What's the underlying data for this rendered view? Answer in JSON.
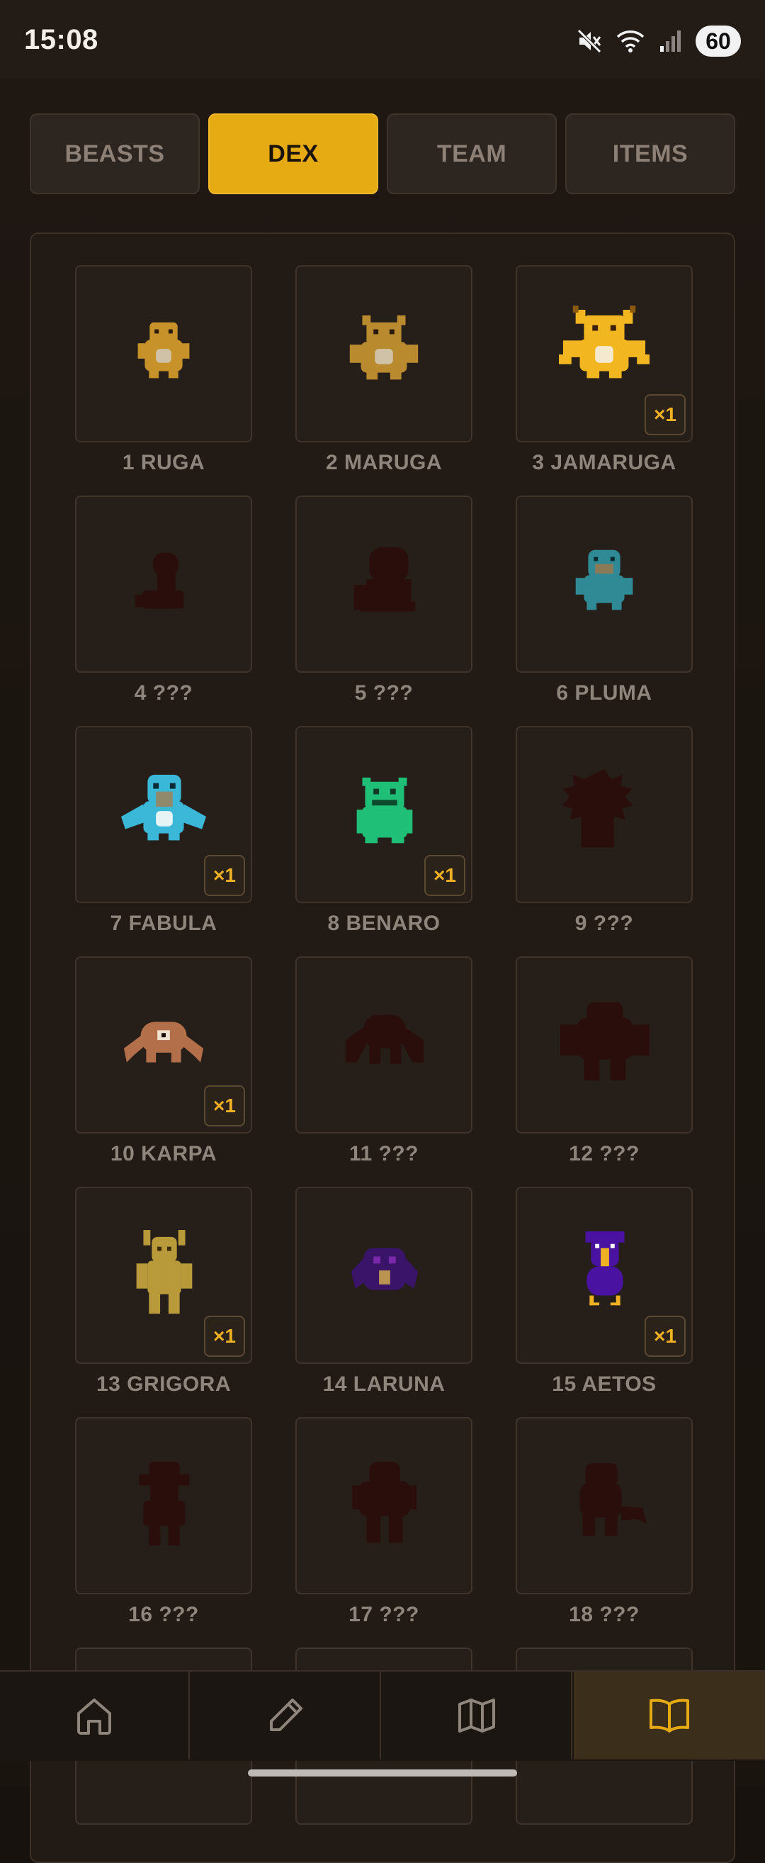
{
  "status": {
    "time": "15:08",
    "battery": "60"
  },
  "tabs": [
    {
      "label": "BEASTS",
      "active": false
    },
    {
      "label": "DEX",
      "active": true
    },
    {
      "label": "TEAM",
      "active": false
    },
    {
      "label": "ITEMS",
      "active": false
    }
  ],
  "dex": [
    {
      "label": "1 RUGA",
      "sprite": "ruga",
      "count": ""
    },
    {
      "label": "2 MARUGA",
      "sprite": "maruga",
      "count": ""
    },
    {
      "label": "3 JAMARUGA",
      "sprite": "jamaruga",
      "count": "×1"
    },
    {
      "label": "4 ???",
      "sprite": "silhouette-small",
      "count": ""
    },
    {
      "label": "5 ???",
      "sprite": "silhouette-medium",
      "count": ""
    },
    {
      "label": "6 PLUMA",
      "sprite": "pluma",
      "count": ""
    },
    {
      "label": "7 FABULA",
      "sprite": "fabula",
      "count": "×1"
    },
    {
      "label": "8 BENARO",
      "sprite": "benaro",
      "count": "×1"
    },
    {
      "label": "9 ???",
      "sprite": "silhouette-spiky",
      "count": ""
    },
    {
      "label": "10 KARPA",
      "sprite": "karpa",
      "count": "×1"
    },
    {
      "label": "11 ???",
      "sprite": "silhouette-crab",
      "count": ""
    },
    {
      "label": "12 ???",
      "sprite": "silhouette-brute",
      "count": ""
    },
    {
      "label": "13 GRIGORA",
      "sprite": "grigora",
      "count": "×1"
    },
    {
      "label": "14 LARUNA",
      "sprite": "laruna",
      "count": ""
    },
    {
      "label": "15 AETOS",
      "sprite": "aetos",
      "count": "×1"
    },
    {
      "label": "16 ???",
      "sprite": "silhouette-hat",
      "count": ""
    },
    {
      "label": "17 ???",
      "sprite": "silhouette-ogre",
      "count": ""
    },
    {
      "label": "18 ???",
      "sprite": "silhouette-lizard",
      "count": ""
    }
  ],
  "bottom_nav": [
    {
      "name": "home",
      "icon": "home-icon",
      "active": false
    },
    {
      "name": "edit",
      "icon": "pencil-icon",
      "active": false
    },
    {
      "name": "map",
      "icon": "map-icon",
      "active": false
    },
    {
      "name": "dex",
      "icon": "book-icon",
      "active": true
    }
  ],
  "colors": {
    "accent": "#e6aa12",
    "badge_text": "#efb023",
    "silhouette": "#2a0e0c"
  }
}
